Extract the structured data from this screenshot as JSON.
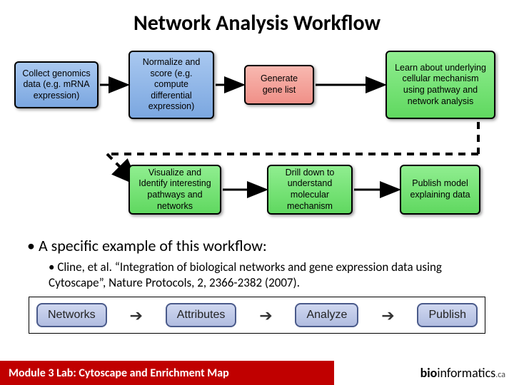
{
  "title": "Network Analysis Workflow",
  "boxes": {
    "b1": "Collect genomics data (e.g. mRNA expression)",
    "b2": "Normalize and score (e.g. compute differential expression)",
    "b3": "Generate gene list",
    "b4": "Learn about underlying cellular mechanism using pathway and network analysis",
    "b5": "Visualize and Identify interesting pathways and networks",
    "b6": "Drill down to understand molecular mechanism",
    "b7": "Publish model explaining data"
  },
  "bullet1": "A specific example of this workflow:",
  "bullet2": "Cline, et al. “Integration of biological networks and gene expression data using Cytoscape”, Nature Protocols, 2, 2366-2382 (2007).",
  "pipeline": {
    "p1": "Networks",
    "p2": "Attributes",
    "p3": "Analyze",
    "p4": "Publish"
  },
  "footer": {
    "left": "Module 3 Lab: Cytoscape and Enrichment Map",
    "brand_bold": "bio",
    "brand_rest": "informatics",
    "brand_ca": ".ca"
  },
  "colors": {
    "blue": "#8fb6e8",
    "red": "#f5a29a",
    "green": "#78e078",
    "footer_red": "#c00000",
    "pipeline_box": "#c0cce8"
  }
}
